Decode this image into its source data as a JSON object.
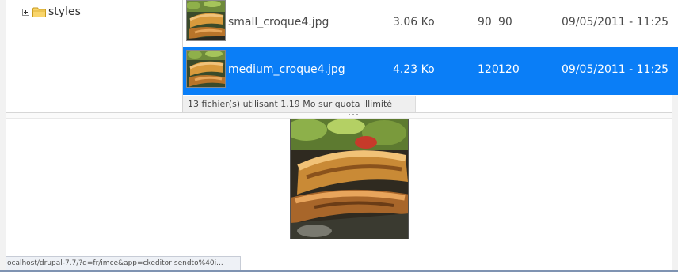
{
  "tree": {
    "items": [
      {
        "label": "styles"
      }
    ]
  },
  "files": [
    {
      "name": "small_croque4.jpg",
      "size": "3.06 Ko",
      "width": "90",
      "height": "90",
      "date": "09/05/2011 - 11:25",
      "selected": false
    },
    {
      "name": "medium_croque4.jpg",
      "size": "4.23 Ko",
      "width": "120",
      "height": "120",
      "date": "09/05/2011 - 11:25",
      "selected": true
    }
  ],
  "status": {
    "text": "13 fichier(s) utilisant 1.19 Mo sur quota illimité"
  },
  "browser_status": {
    "url": "ocalhost/drupal-7.7/?q=fr/imce&app=ckeditor|sendto%40i..."
  },
  "colors": {
    "selection": "#0a7ef7",
    "folder": "#f4c64c"
  },
  "icons": {
    "expander": "plus-box-icon",
    "folder": "folder-icon"
  }
}
